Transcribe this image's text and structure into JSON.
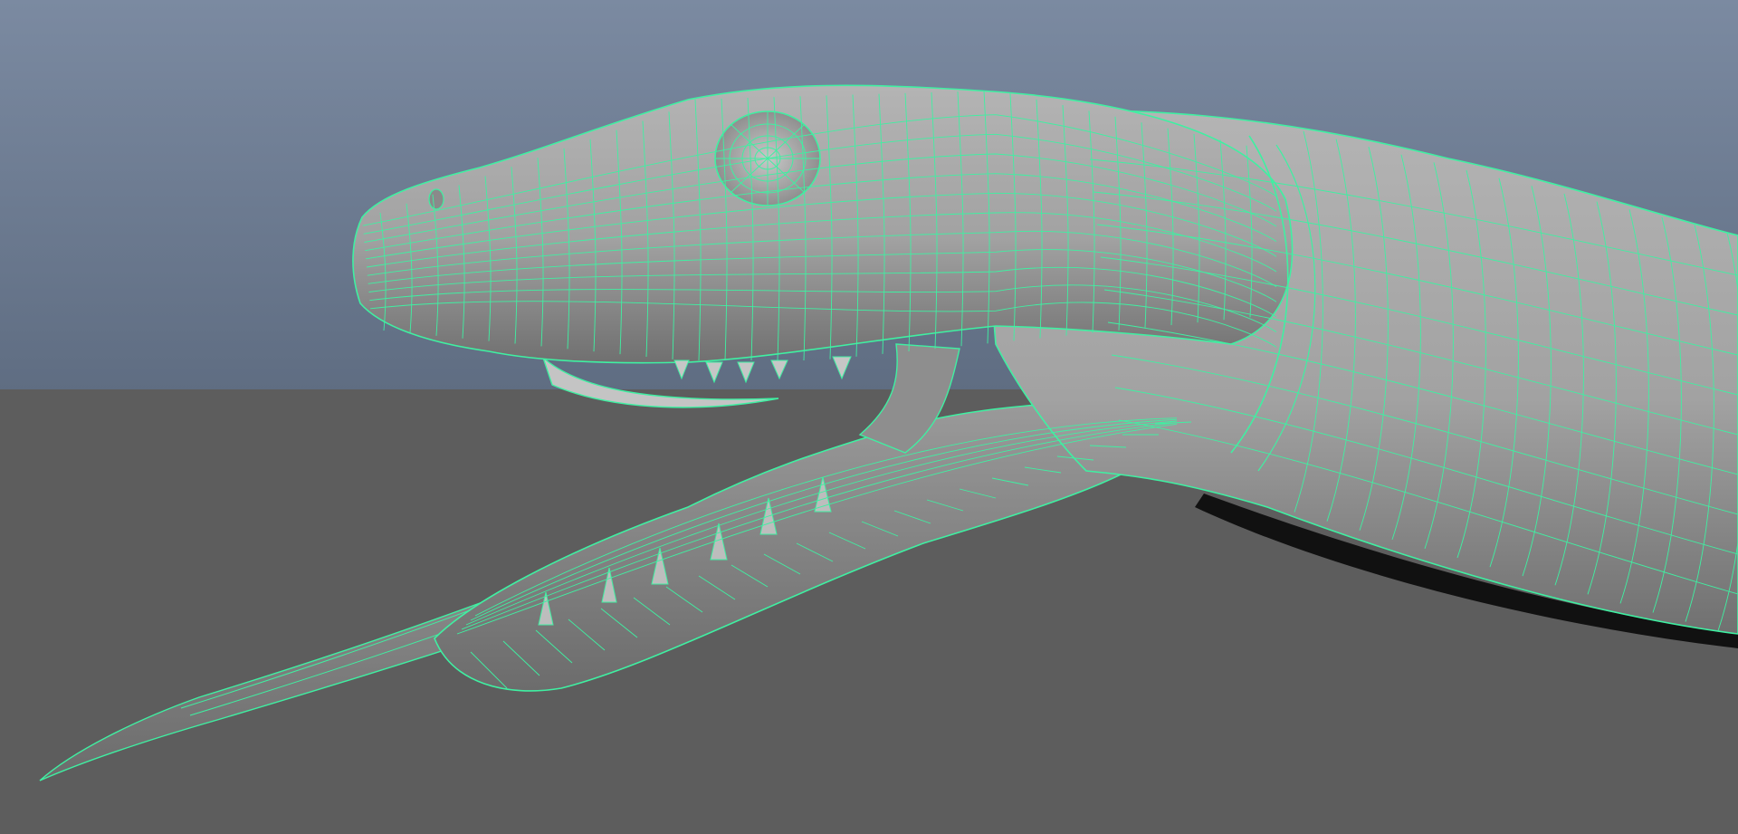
{
  "viewport": {
    "object": "snake-head-model",
    "display_mode": "wireframe-on-shaded",
    "colors": {
      "sky_top": "#7b8aa1",
      "sky_bottom": "#5f6d82",
      "ground": "#5d5d5d",
      "mesh_shade_light": "#a8a8a8",
      "mesh_shade_dark": "#6a6a6a",
      "wire": "#3ff0a2",
      "shadow": "#111111"
    }
  }
}
